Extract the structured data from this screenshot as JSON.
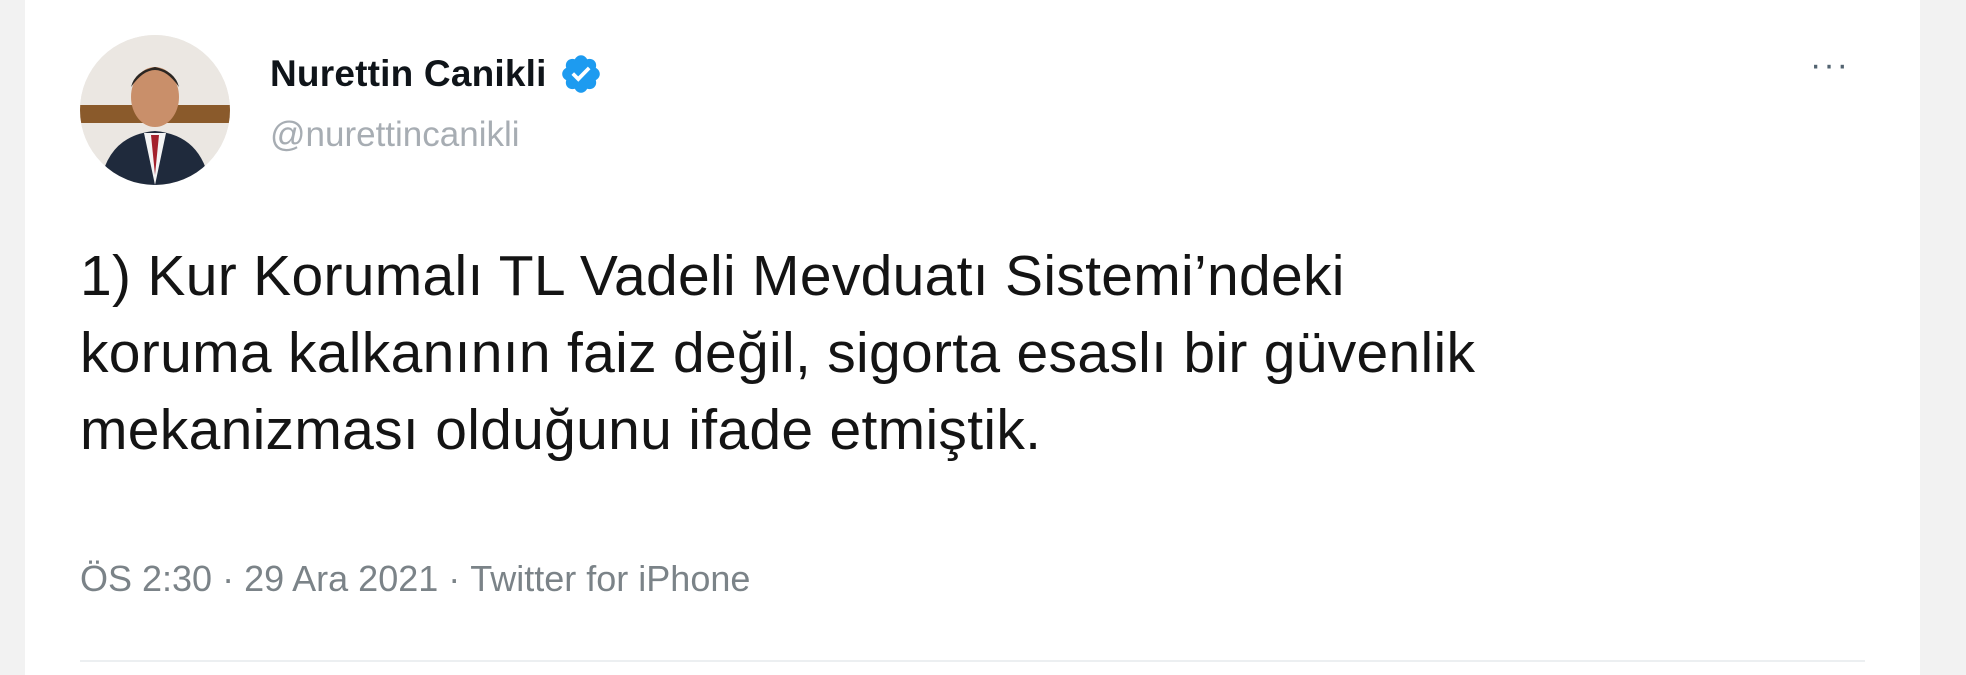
{
  "author": {
    "display_name": "Nurettin Canikli",
    "handle": "@nurettincanikli",
    "verified": true,
    "verified_icon": "verified-badge-icon",
    "accent_color": "#1d9bf0"
  },
  "menu": {
    "more_label": "···"
  },
  "tweet": {
    "lines": [
      "1) Kur Korumalı TL Vadeli Mevduatı Sistemi’ndeki",
      "koruma kalkanının faiz değil, sigorta esaslı bir güvenlik",
      "mekanizması olduğunu ifade etmiştik."
    ]
  },
  "meta": {
    "time": "ÖS 2:30",
    "separator": "·",
    "date": "29 Ara 2021",
    "source": "Twitter for iPhone"
  }
}
